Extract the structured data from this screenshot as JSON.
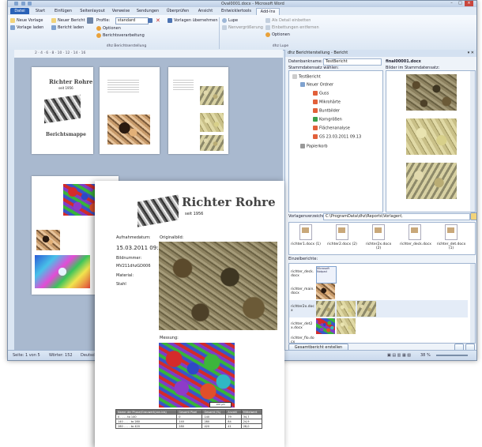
{
  "window": {
    "title": "Oval0001.docx - Microsoft Word"
  },
  "tabs": [
    "Datei",
    "Start",
    "Einfügen",
    "Seitenlayout",
    "Verweise",
    "Sendungen",
    "Überprüfen",
    "Ansicht",
    "Entwicklertools",
    "Add-Ins"
  ],
  "ribbon": {
    "new_template": "Neue Vorlage",
    "load_template": "Vorlage laden",
    "new_report": "Neuer Bericht",
    "load_report": "Bericht laden",
    "profile_label": "Profile:",
    "profile_value": "standard",
    "options": "Optionen",
    "report_processing": "Berichtsverarbeitung",
    "take_templates": "Vorlagen übernehmen",
    "magnifier": "Lupe",
    "magnifier_zoom": "Nenvergrößerung",
    "insert_detail": "Als Detail einbetten",
    "remove_insertions": "Einbettungen entfernen",
    "options2": "Optionen",
    "group1": "dhz Berichtserstellung",
    "group2": "dhz Lupe"
  },
  "ruler_numbers": "2 · 4 · 6 · 8 · 10 · 12 · 14 · 16",
  "status": {
    "page": "Seite: 1 von 5",
    "words": "Wörter: 152",
    "lang": "Deutsch (Deutschland)",
    "zoom": "38 %"
  },
  "panel": {
    "header": "dhz Berichterstellung - Bericht",
    "db_label": "Datenbankname:",
    "db_value": "TestBericht",
    "doc_name": "final00001.docx",
    "master_label": "Stammdatensatz wählen:",
    "images_label": "Bilder im Stammdatensatz:",
    "tree": {
      "root": "TestBericht",
      "folder": "Neuer Ordner",
      "items": [
        "Guss",
        "Mikrohärte",
        "Buntbilder",
        "Korngrößen",
        "Flächenanalyse",
        "GS 23.03.2011 09.13"
      ],
      "trash": "Papierkorb"
    },
    "template_dir_label": "Vorlagenverzeichnis:",
    "template_dir_value": "C:\\ProgramData\\dhz\\Reports\\Vorlagen\\",
    "templates": [
      "richter1.docx (1)",
      "richter2.docx (2)",
      "richter2x.docx (2)",
      "richter_deck.docx",
      "richter_det.docx (1)"
    ],
    "single_reports_label": "Einzelberichte:",
    "single_reports": [
      "richter_deck.docx",
      "richter_main.docx",
      "richter2x.docx",
      "richter_det2x.docx",
      "richter_flo.docx"
    ],
    "total_report_button": "Gesamtbericht erstellen",
    "thumb_badge": "Microsoft Notpad"
  },
  "cover": {
    "brand": "Richter Rohre",
    "since": "seit 1956",
    "title": "Berichtsmappe"
  },
  "report": {
    "brand": "Richter Rohre",
    "since": "seit 1956",
    "recorded_label": "Aufnahmedatum:",
    "recorded_value": "15.03.2011 09:11:19",
    "number_label": "Bildnummer:",
    "number_value": "MV211dhzGD006",
    "material_label": "Material:",
    "material_value": "Stahl",
    "original_label": "Originalbild:",
    "measure_label": "Messung:",
    "scale": "100 µm",
    "table_header": [
      "Name der Phase/Grauwert(von-bis)",
      "Gesamt Pixel",
      "Gesamt (%)",
      "Anzahl",
      "Mittelwert"
    ],
    "table_rows": [
      [
        "0 . . . . to 140",
        "0",
        "140",
        "79",
        "34,7"
      ],
      [
        "140 . . . . to 280",
        "140",
        "280",
        "84",
        "24,9"
      ],
      [
        "280 . . . . to 420",
        "280",
        "420",
        "41",
        "28,0"
      ]
    ]
  }
}
